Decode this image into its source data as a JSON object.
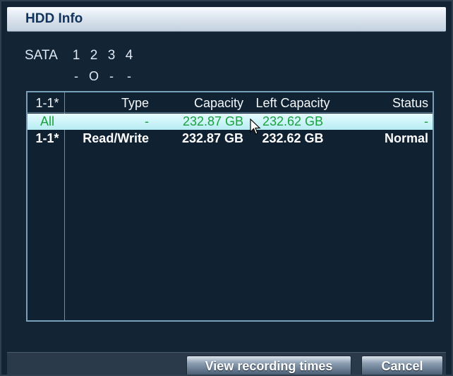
{
  "window": {
    "title": "HDD Info"
  },
  "sata": {
    "label": "SATA",
    "slots": [
      "1",
      "2",
      "3",
      "4"
    ],
    "states": [
      "-",
      "O",
      "-",
      "-"
    ]
  },
  "table": {
    "headers": {
      "id": "1-1*",
      "type": "Type",
      "capacity": "Capacity",
      "left_capacity": "Left Capacity",
      "status": "Status"
    },
    "rows": [
      {
        "id": "All",
        "type": "-",
        "capacity": "232.87 GB",
        "left_capacity": "232.62 GB",
        "status": "-"
      },
      {
        "id": "1-1*",
        "type": "Read/Write",
        "capacity": "232.87 GB",
        "left_capacity": "232.62 GB",
        "status": "Normal"
      }
    ]
  },
  "buttons": {
    "view_recording_times": "View recording times",
    "cancel": "Cancel"
  },
  "colors": {
    "title_text": "#11345f",
    "selected_row_text": "#18a23b",
    "selected_row_bg": "#c9f4f8",
    "background": "#132434"
  },
  "icons": {
    "cursor": "mouse-pointer-icon"
  }
}
